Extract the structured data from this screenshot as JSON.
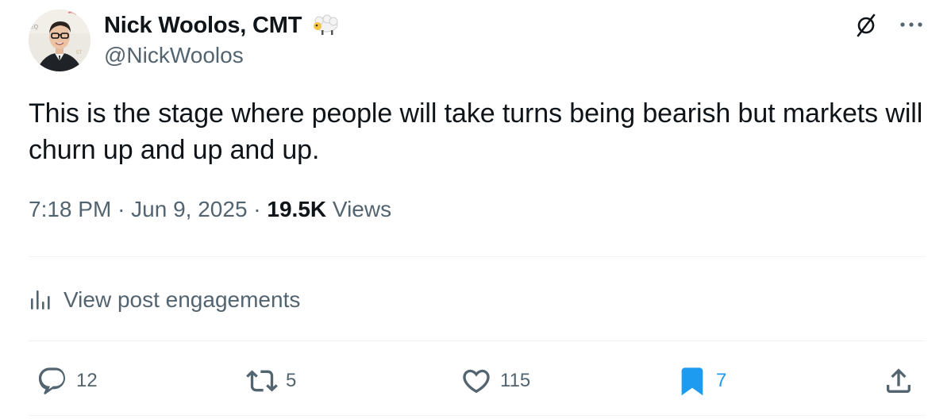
{
  "author": {
    "display_name": "Nick Woolos, CMT",
    "handle": "@NickWoolos",
    "badge_icon": "sheep-emoji-icon",
    "avatar": "avatar-photo"
  },
  "header_actions": {
    "grok_icon": "grok-slash-icon",
    "more_icon": "more-dots-icon"
  },
  "tweet": {
    "text": "This is the stage where people will take turns being bearish but markets will churn up and up and up."
  },
  "meta": {
    "time": "7:18 PM",
    "separator": "·",
    "date": "Jun 9, 2025",
    "views_count": "19.5K",
    "views_label": "Views"
  },
  "engagements": {
    "label": "View post engagements",
    "icon": "bar-chart-icon"
  },
  "actions": {
    "reply": {
      "count": "12",
      "icon": "reply-icon"
    },
    "retweet": {
      "count": "5",
      "icon": "retweet-icon"
    },
    "like": {
      "count": "115",
      "icon": "heart-icon"
    },
    "bookmark": {
      "count": "7",
      "icon": "bookmark-icon",
      "active": true,
      "color": "#1d9bf0"
    },
    "share": {
      "icon": "share-icon"
    }
  },
  "colors": {
    "primary_text": "#0f1419",
    "secondary_text": "#536471",
    "accent": "#1d9bf0",
    "divider": "#eff3f4"
  }
}
